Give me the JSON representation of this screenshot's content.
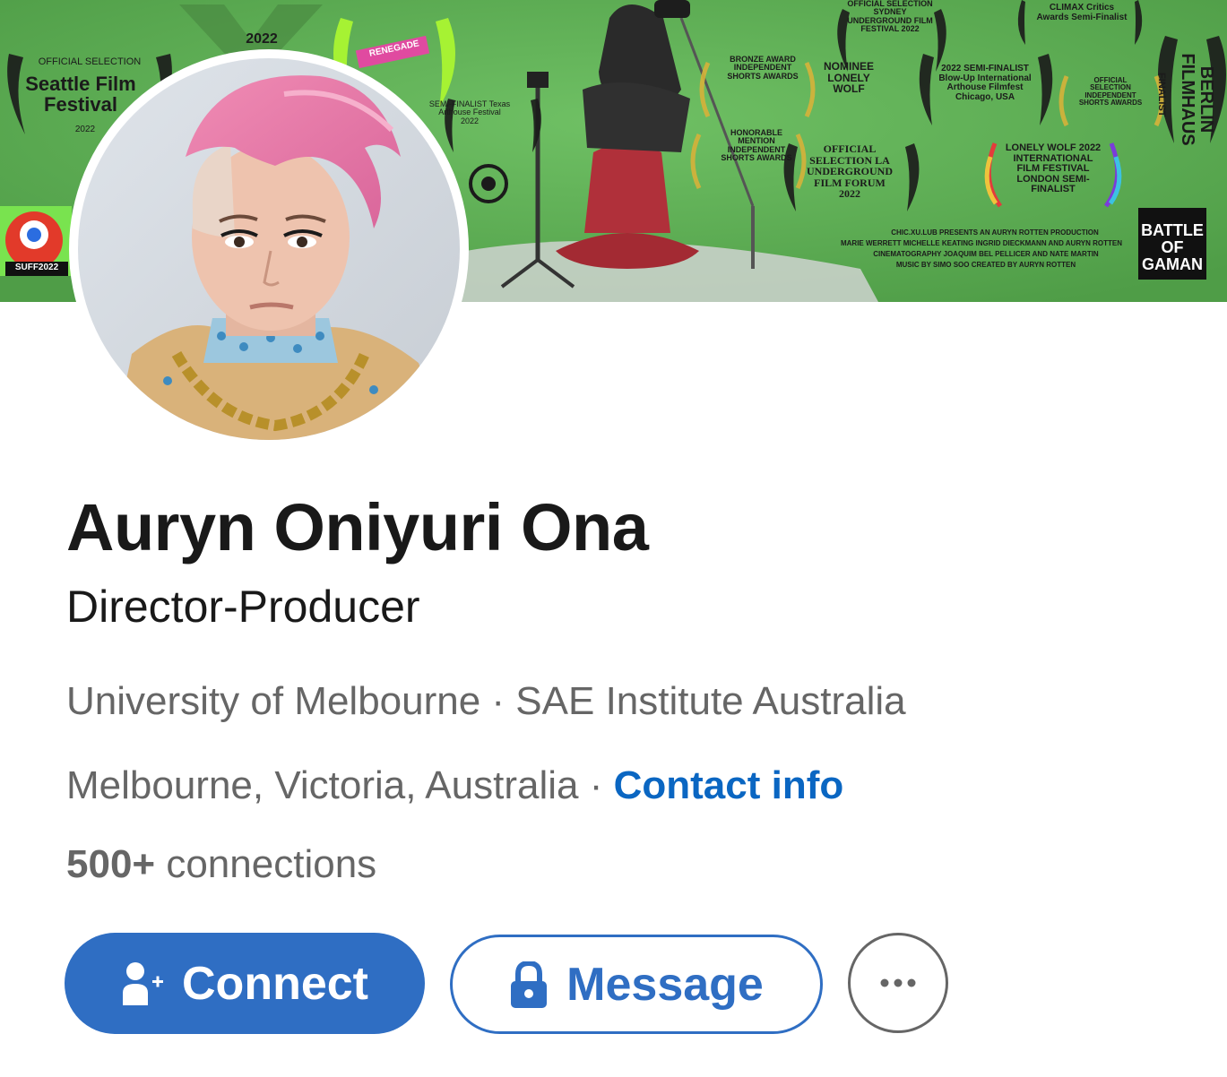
{
  "profile": {
    "name": "Auryn Oniyuri Ona",
    "headline": "Director-Producer",
    "education": "University of Melbourne · SAE Institute Australia",
    "location": "Melbourne, Victoria, Australia",
    "location_separator": " · ",
    "contact_link": "Contact info",
    "connections_count": "500+",
    "connections_label": " connections"
  },
  "actions": {
    "connect_label": "Connect",
    "message_label": "Message",
    "more_label": "···"
  },
  "banner": {
    "seattle_selection": "OFFICIAL SELECTION",
    "seattle_title": "Seattle Film Festival",
    "seattle_year": "2022",
    "top_year": "2022",
    "renegade": "RENEGADE",
    "texas": "SEMI-FINALIST Texas Arthouse Festival 2022",
    "sydney": "OFFICIAL SELECTION SYDNEY UNDERGROUND FILM FESTIVAL 2022",
    "climax": "CLIMAX Critics Awards Semi-Finalist",
    "iss_bronze": "BRONZE AWARD INDEPENDENT SHORTS AWARDS",
    "iss_honorable": "HONORABLE MENTION INDEPENDENT SHORTS AWARDS",
    "lonely_wolf_nominee": "NOMINEE LONELY WOLF",
    "la_underground": "OFFICIAL SELECTION LA UNDERGROUND FILM FORUM 2022",
    "blowup": "2022 SEMI-FINALIST Blow-Up International Arthouse Filmfest Chicago, USA",
    "iss_official": "OFFICIAL SELECTION INDEPENDENT SHORTS AWARDS",
    "lonely_wolf_semi": "LONELY WOLF 2022 INTERNATIONAL FILM FESTIVAL LONDON SEMI-FINALIST",
    "filmhaus": "BERLIN FILMHAUS",
    "filmhaus_finalist": "FINALIST",
    "battle": "BATTLE OF GAMAN",
    "suff": "SUFF2022",
    "credits_1": "CHIC.XU.LUB PRESENTS AN AURYN ROTTEN PRODUCTION",
    "credits_2": "MARIE WERRETT  MICHELLE KEATING  INGRID DIECKMANN AND AURYN ROTTEN",
    "credits_3": "CINEMATOGRAPHY JOAQUIM BEL PELLICER AND NATE MARTIN",
    "credits_4": "MUSIC BY SIMO SOO  CREATED BY AURYN ROTTEN"
  },
  "colors": {
    "primary_blue": "#0a66c2",
    "button_blue": "#2f6ec3",
    "banner_green": "#5cae52",
    "muted_text": "#666666"
  },
  "icons": [
    "add-person-icon",
    "lock-icon",
    "more-dots-icon"
  ]
}
